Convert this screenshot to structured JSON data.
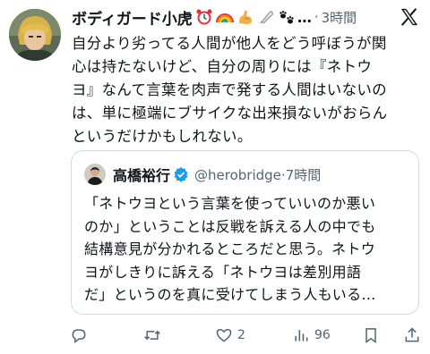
{
  "post": {
    "author_name": "ボディガード小虎",
    "name_emojis": [
      "alarm-clock-emoji",
      "rainbow-emoji",
      "flexed-biceps-emoji",
      "safety-pin-emoji",
      "paw-prints-emoji"
    ],
    "ellipsis": "…",
    "dot": "·",
    "time": "3時間",
    "text_lines": [
      "自分より劣ってる人間が他人をどう呼ぼうが関",
      "心は持たないけど、自分の周りには『ネトウ",
      "ヨ』なんて言葉を肉声で発する人間はいないの",
      "は、単に極端にブサイクな出来損ないがおらん",
      "というだけかもしれない。"
    ]
  },
  "quote": {
    "author_name": "高橋裕行",
    "handle": "@herobridge",
    "time": "7時間",
    "text_lines": [
      "「ネトウヨという言葉を使っていいのか悪い",
      "のか」ということは反戦を訴える人の中でも",
      "結構意見が分かれるところだと思う。ネトウ",
      "ヨがしきりに訴える「ネトウヨは差別用語",
      "だ」というのを真に受けてしまう人もいる…"
    ]
  },
  "actions": {
    "reply_count": "",
    "repost_count": "",
    "like_count": "2",
    "views_count": "96"
  },
  "colors": {
    "text": "#0f1419",
    "secondary": "#536471",
    "border": "#cfd9de",
    "verified": "#1d9bf0"
  }
}
